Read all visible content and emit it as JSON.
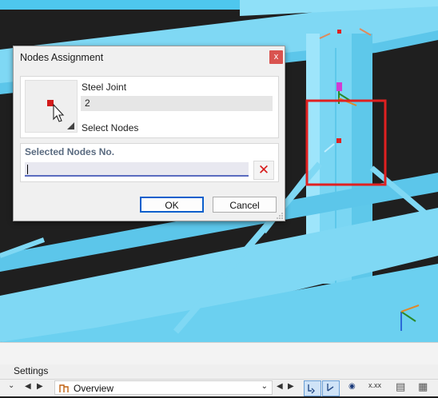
{
  "dialog": {
    "title": "Nodes Assignment",
    "close_glyph": "x",
    "joint_label": "Steel Joint",
    "joint_value": "2",
    "select_nodes_label": "Select Nodes",
    "selected_nodes_title": "Selected Nodes No.",
    "selected_nodes_value": "",
    "clear_glyph": "✕",
    "ok_label": "OK",
    "cancel_label": "Cancel"
  },
  "bottom": {
    "settings_label": "Settings",
    "view_combo": "Overview",
    "icons": [
      "chevron-down-icon",
      "nav-prev-icon",
      "nav-next-icon",
      "structure-icon",
      "combo-dropdown-icon",
      "select-mode-icon",
      "node-select-icon",
      "view-eye-icon",
      "numbering-icon",
      "table-icon",
      "grid-icon"
    ]
  },
  "colors": {
    "accent": "#0a5fcc",
    "beam": "#7fd8f4",
    "background": "#1f1f1f",
    "highlight": "#e02020"
  }
}
